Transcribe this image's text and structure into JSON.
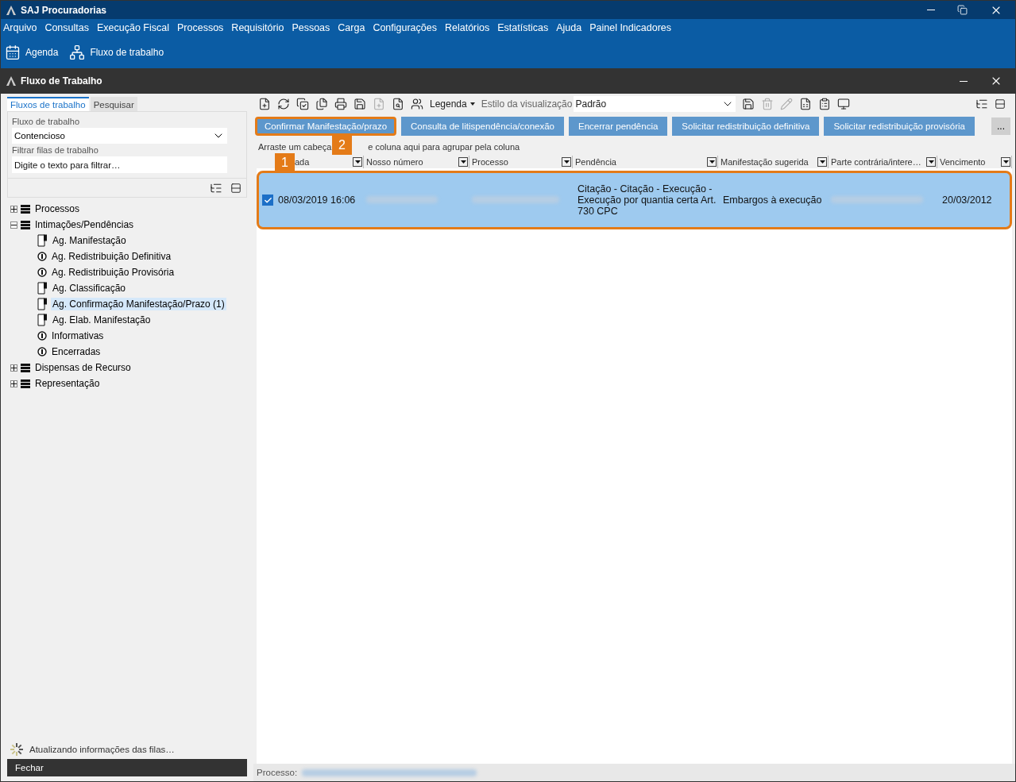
{
  "app_title": "SAJ Procuradorias",
  "menu": [
    "Arquivo",
    "Consultas",
    "Execução Fiscal",
    "Processos",
    "Requisitório",
    "Pessoas",
    "Carga",
    "Configurações",
    "Relatórios",
    "Estatísticas",
    "Ajuda",
    "Painel Indicadores"
  ],
  "toolbar": [
    {
      "label": "Agenda",
      "kind": "calendar"
    },
    {
      "label": "Fluxo de trabalho",
      "kind": "hierarchy"
    }
  ],
  "window": {
    "title": "Fluxo de Trabalho"
  },
  "left_panel": {
    "tabs": [
      {
        "label": "Fluxos de trabalho",
        "selected": true
      },
      {
        "label": "Pesquisar",
        "selected": false
      }
    ],
    "flow_label": "Fluxo de trabalho",
    "flow_value": "Contencioso",
    "filter_label": "Filtrar filas de trabalho",
    "filter_placeholder": "Digite o texto para filtrar…",
    "tree": [
      {
        "label": "Processos",
        "kind": "group",
        "expanded": false,
        "selected": false
      },
      {
        "label": "Intimações/Pendências",
        "kind": "group",
        "expanded": true,
        "selected": false,
        "children": [
          {
            "label": "Ag. Manifestação",
            "kind": "document",
            "selected": false
          },
          {
            "label": "Ag. Redistribuição Definitiva",
            "kind": "info",
            "selected": false
          },
          {
            "label": "Ag. Redistribuição Provisória",
            "kind": "info",
            "selected": false
          },
          {
            "label": "Ag. Classificação",
            "kind": "document",
            "selected": false
          },
          {
            "label": "Ag. Confirmação Manifestação/Prazo (1)",
            "kind": "document",
            "selected": true
          },
          {
            "label": "Ag. Elab. Manifestação",
            "kind": "document",
            "selected": false
          },
          {
            "label": "Informativas",
            "kind": "info",
            "selected": false
          },
          {
            "label": "Encerradas",
            "kind": "info",
            "selected": false
          }
        ]
      },
      {
        "label": "Dispensas de Recurso",
        "kind": "group",
        "expanded": false,
        "selected": false
      },
      {
        "label": "Representação",
        "kind": "group",
        "expanded": false,
        "selected": false
      }
    ],
    "status": "Atualizando informações das filas…",
    "close_button": "Fechar"
  },
  "view_toolbar": {
    "legend": "Legenda",
    "style_label": "Estilo da visualização",
    "style_value": "Padrão"
  },
  "action_buttons": [
    {
      "label": "Confirmar Manifestação/prazo",
      "highlighted": true
    },
    {
      "label": "Consulta de litispendência/conexão",
      "highlighted": false
    },
    {
      "label": "Encerrar pendência",
      "highlighted": false
    },
    {
      "label": "Solicitar redistribuição definitiva",
      "highlighted": false
    },
    {
      "label": "Solicitar redistribuição provisória",
      "highlighted": false
    }
  ],
  "more_button": "...",
  "group_hint": [
    "Arraste um cabeça",
    "e coluna aqui para agrupar pela coluna"
  ],
  "callouts": [
    "1",
    "2"
  ],
  "table": {
    "columns": [
      "ada",
      "Nosso número",
      "Processo",
      "Pendência",
      "Manifestação sugerida",
      "Parte contrária/intere…",
      "Vencimento"
    ],
    "rows": [
      {
        "checked": true,
        "selected": true,
        "date": "08/03/2019 16:06",
        "pendencia": "Citação - Citação - Execução - Execução por quantia certa Art. 730 CPC",
        "manifestacao": "Embargos à execução",
        "vencimento": "20/03/2012"
      }
    ]
  },
  "status_bar": {
    "label": "Processo:"
  }
}
